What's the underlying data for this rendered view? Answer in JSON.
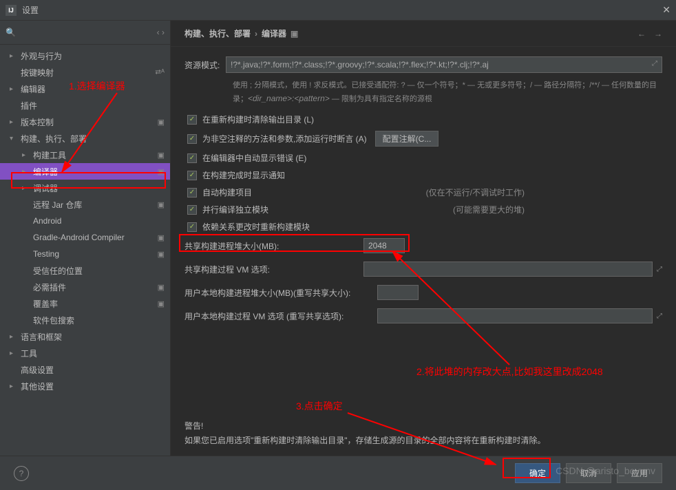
{
  "window": {
    "title": "设置"
  },
  "search": {
    "placeholder": ""
  },
  "sidebar": {
    "items": [
      {
        "label": "外观与行为",
        "expandable": true
      },
      {
        "label": "按键映射",
        "expandable": false,
        "badge": "⮂ᴬ"
      },
      {
        "label": "编辑器",
        "expandable": true
      },
      {
        "label": "插件",
        "expandable": false,
        "badge": ""
      },
      {
        "label": "版本控制",
        "expandable": true,
        "badge": "▣"
      },
      {
        "label": "构建、执行、部署",
        "expandable": true,
        "expanded": true
      },
      {
        "label": "构建工具",
        "expandable": true,
        "indent": 1,
        "badge": "▣"
      },
      {
        "label": "编译器",
        "expandable": true,
        "indent": 1,
        "selected": true,
        "badge": "▣"
      },
      {
        "label": "调试器",
        "expandable": true,
        "indent": 1
      },
      {
        "label": "远程 Jar 仓库",
        "indent": 1,
        "badge": "▣"
      },
      {
        "label": "Android",
        "indent": 1
      },
      {
        "label": "Gradle-Android Compiler",
        "indent": 1,
        "badge": "▣"
      },
      {
        "label": "Testing",
        "indent": 1,
        "badge": "▣"
      },
      {
        "label": "受信任的位置",
        "indent": 1
      },
      {
        "label": "必需插件",
        "indent": 1,
        "badge": "▣"
      },
      {
        "label": "覆盖率",
        "indent": 1,
        "badge": "▣"
      },
      {
        "label": "软件包搜索",
        "indent": 1
      },
      {
        "label": "语言和框架",
        "expandable": true
      },
      {
        "label": "工具",
        "expandable": true
      },
      {
        "label": "高级设置"
      },
      {
        "label": "其他设置",
        "expandable": true
      }
    ]
  },
  "breadcrumb": {
    "part1": "构建、执行、部署",
    "part2": "编译器",
    "badge": "▣"
  },
  "form": {
    "pattern_label": "资源模式:",
    "pattern_value": "!?*.java;!?*.form;!?*.class;!?*.groovy;!?*.scala;!?*.flex;!?*.kt;!?*.clj;!?*.aj",
    "hint": "使用 ; 分隔模式，使用 ! 求反模式。已接受通配符: ? — 仅一个符号；* — 无或更多符号；/ — 路径分隔符；/**/ — 任何数量的目录；<dir_name>:<pattern> — 限制为具有指定名称的源根",
    "checks": [
      {
        "label": "在重新构建时清除输出目录 (L)",
        "checked": true
      },
      {
        "label": "为非空注释的方法和参数,添加运行时断言 (A)",
        "checked": true,
        "button": "配置注解(C..."
      },
      {
        "label": "在编辑器中自动显示错误 (E)",
        "checked": true
      },
      {
        "label": "在构建完成时显示通知",
        "checked": true
      },
      {
        "label": "自动构建项目",
        "checked": true,
        "note": "(仅在不运行/不调试时工作)"
      },
      {
        "label": "并行编译独立模块",
        "checked": true,
        "note": "(可能需要更大的堆)"
      },
      {
        "label": "依赖关系更改时重新构建模块",
        "checked": true
      }
    ],
    "heap_label": "共享构建进程堆大小(MB):",
    "heap_value": "2048",
    "vm_label": "共享构建过程 VM 选项:",
    "vm_value": "",
    "user_heap_label": "用户本地构建进程堆大小(MB)(重写共享大小):",
    "user_heap_value": "",
    "user_vm_label": "用户本地构建过程 VM 选项 (重写共享选项):",
    "user_vm_value": "",
    "warning_title": "警告!",
    "warning_text": "如果您已启用选项\"重新构建时清除输出目录\"，存储生成源的目录的全部内容将在重新构建时清除。"
  },
  "footer": {
    "ok": "确定",
    "cancel": "取消",
    "apply": "应用"
  },
  "annotations": {
    "a1": "1.选择编译器",
    "a2": "2.将此堆的内存改大点,比如我这里改成2048",
    "a3": "3.点击确定"
  },
  "watermark": "CSDN @aristo_boyunv"
}
